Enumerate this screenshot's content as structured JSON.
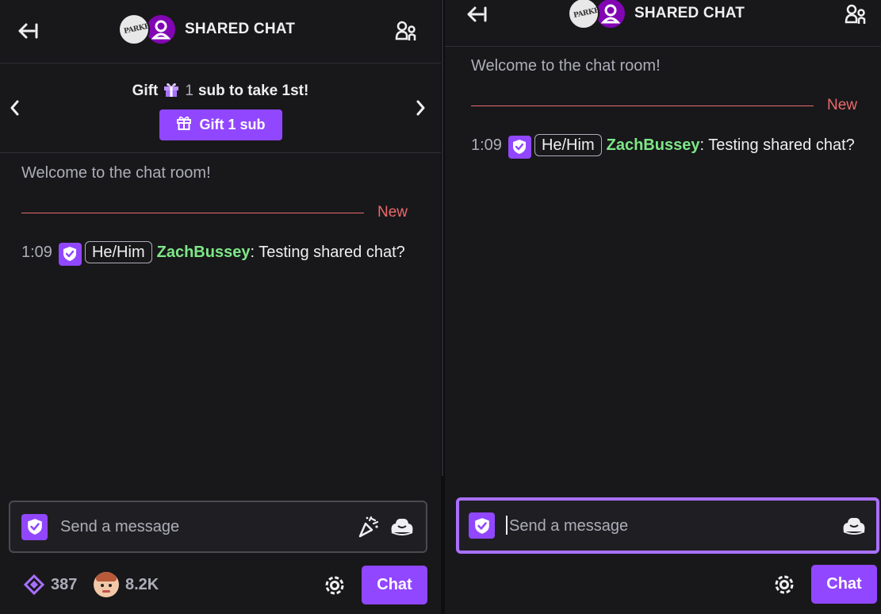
{
  "left_panel": {
    "header": {
      "title": "SHARED CHAT",
      "icons": [
        "collapse-arrow-icon",
        "community-users-icon"
      ]
    },
    "gift_banner": {
      "text_before": "Gift",
      "count": "1",
      "text_after": "sub to take 1st!",
      "button_label": "Gift 1 sub"
    },
    "welcome": "Welcome to the chat room!",
    "new_label": "New",
    "message": {
      "time": "1:09",
      "pronoun": "He/Him",
      "username": "ZachBussey",
      "text": "Testing shared chat?"
    },
    "input": {
      "placeholder": "Send a message"
    },
    "footer": {
      "points": "387",
      "viewers": "8.2K",
      "chat_button": "Chat"
    }
  },
  "right_panel": {
    "header": {
      "title": "SHARED CHAT"
    },
    "welcome": "Welcome to the chat room!",
    "new_label": "New",
    "message": {
      "time": "1:09",
      "pronoun": "He/Him",
      "username": "ZachBussey",
      "text": "Testing shared chat?"
    },
    "input": {
      "placeholder": "Send a message"
    },
    "footer": {
      "chat_button": "Chat"
    }
  },
  "colors": {
    "accent": "#9147ff",
    "username": "#7ee787",
    "new_divider": "#eb6a6a",
    "background": "#18181b"
  }
}
